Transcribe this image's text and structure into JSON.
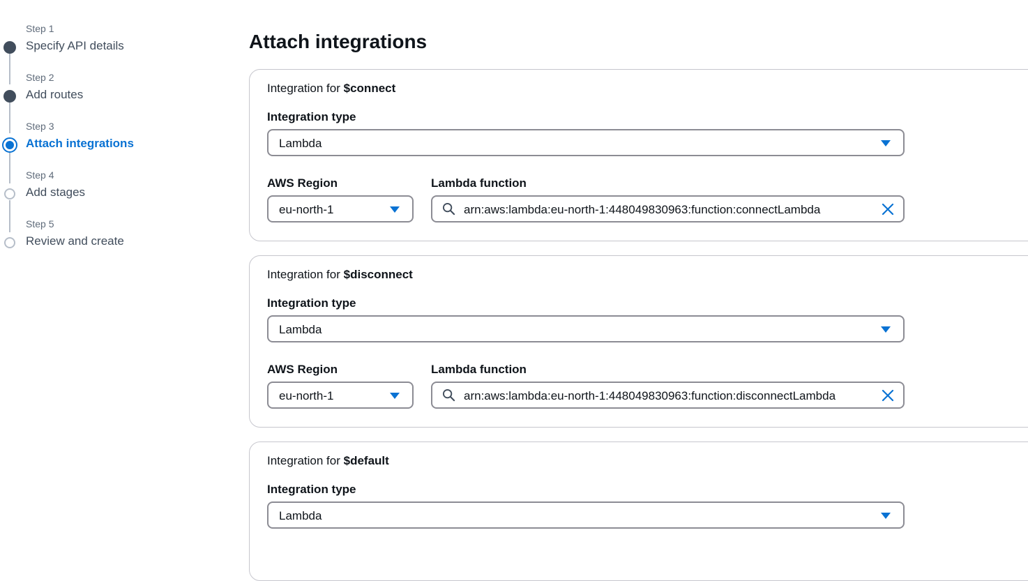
{
  "wizard": {
    "steps": [
      {
        "number": "Step 1",
        "title": "Specify API details",
        "state": "done"
      },
      {
        "number": "Step 2",
        "title": "Add routes",
        "state": "done"
      },
      {
        "number": "Step 3",
        "title": "Attach integrations",
        "state": "active"
      },
      {
        "number": "Step 4",
        "title": "Add stages",
        "state": "todo"
      },
      {
        "number": "Step 5",
        "title": "Review and create",
        "state": "todo"
      }
    ]
  },
  "page": {
    "title": "Attach integrations"
  },
  "labels": {
    "integration_for": "Integration for",
    "integration_type": "Integration type",
    "aws_region": "AWS Region",
    "lambda_function": "Lambda function"
  },
  "integrations": [
    {
      "route": "$connect",
      "integration_type": "Lambda",
      "region": "eu-north-1",
      "lambda_function": "arn:aws:lambda:eu-north-1:448049830963:function:connectLambda"
    },
    {
      "route": "$disconnect",
      "integration_type": "Lambda",
      "region": "eu-north-1",
      "lambda_function": "arn:aws:lambda:eu-north-1:448049830963:function:disconnectLambda"
    },
    {
      "route": "$default",
      "integration_type": "Lambda"
    }
  ],
  "icons": {
    "dropdown": "caret-down-icon",
    "search": "search-icon",
    "clear": "close-icon"
  },
  "colors": {
    "accent": "#0972d3",
    "completed_step": "#414d5c",
    "pending_step": "#b6bec9",
    "input_border": "#8c8c94"
  }
}
